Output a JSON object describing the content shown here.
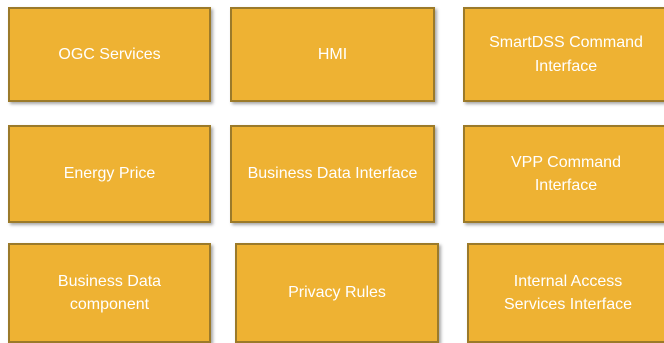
{
  "boxes": [
    {
      "label": "OGC Services"
    },
    {
      "label": "HMI"
    },
    {
      "label": "SmartDSS  Command\nInterface"
    },
    {
      "label": "Energy Price"
    },
    {
      "label": "Business Data Interface"
    },
    {
      "label": "VPP Command\nInterface"
    },
    {
      "label": "Business Data\ncomponent"
    },
    {
      "label": "Privacy  Rules"
    },
    {
      "label": "Internal Access\nServices  Interface"
    }
  ],
  "colors": {
    "box_fill": "#eeb233",
    "box_border": "#9b7a2a",
    "text": "#ffffff"
  }
}
